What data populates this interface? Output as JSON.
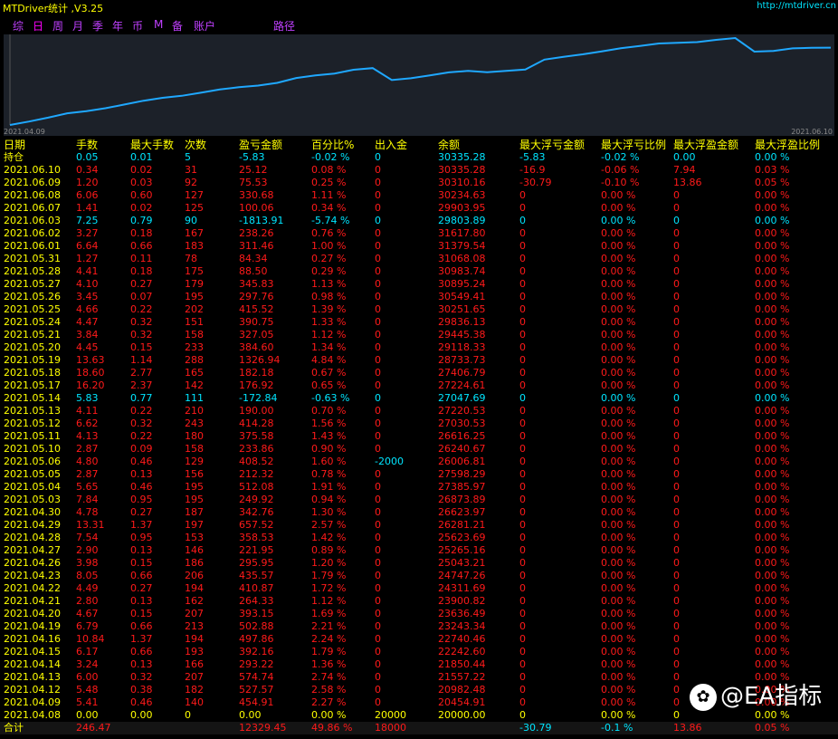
{
  "window": {
    "title": "MTDriver统计 ,V3.25",
    "url": "http://mtdriver.cn"
  },
  "tabs": [
    "综",
    "日",
    "周",
    "月",
    "季",
    "年",
    "币",
    "M",
    "备",
    "账户",
    "路径"
  ],
  "active_tab": 1,
  "chart": {
    "start_label": "2021.04.09",
    "end_label": "2021.06.10",
    "line_color": "#1fa8ff"
  },
  "chart_data": {
    "type": "line",
    "x": [
      "2021.04.08",
      "2021.04.09",
      "2021.04.12",
      "2021.04.13",
      "2021.04.14",
      "2021.04.15",
      "2021.04.16",
      "2021.04.19",
      "2021.04.20",
      "2021.04.21",
      "2021.04.22",
      "2021.04.23",
      "2021.04.26",
      "2021.04.27",
      "2021.04.28",
      "2021.04.29",
      "2021.04.30",
      "2021.05.03",
      "2021.05.04",
      "2021.05.05",
      "2021.05.06",
      "2021.05.10",
      "2021.05.11",
      "2021.05.12",
      "2021.05.13",
      "2021.05.14",
      "2021.05.17",
      "2021.05.18",
      "2021.05.19",
      "2021.05.20",
      "2021.05.21",
      "2021.05.24",
      "2021.05.25",
      "2021.05.26",
      "2021.05.27",
      "2021.05.28",
      "2021.05.31",
      "2021.06.01",
      "2021.06.02",
      "2021.06.03",
      "2021.06.07",
      "2021.06.08",
      "2021.06.09",
      "2021.06.10"
    ],
    "values": [
      20000.0,
      20454.91,
      20982.48,
      21557.22,
      21850.44,
      22242.6,
      22740.46,
      23243.34,
      23636.49,
      23900.82,
      24311.69,
      24747.26,
      25043.21,
      25265.16,
      25623.69,
      26281.21,
      26623.97,
      26873.89,
      27385.97,
      27598.29,
      26006.81,
      26240.67,
      26616.25,
      27030.53,
      27220.53,
      27047.69,
      27224.61,
      27406.79,
      28733.73,
      29118.33,
      29445.38,
      29836.13,
      30251.65,
      30549.41,
      30895.24,
      30983.74,
      31068.08,
      31379.54,
      31617.8,
      29803.89,
      29903.95,
      30234.63,
      30310.16,
      30335.28
    ],
    "xlabel": "",
    "ylabel": "",
    "grid": false
  },
  "table": {
    "headers": [
      "日期",
      "手数",
      "最大手数",
      "次数",
      "盈亏金额",
      "百分比%",
      "出入金",
      "余额",
      "最大浮亏金额",
      "最大浮亏比例",
      "最大浮盈金额",
      "最大浮盈比例"
    ],
    "rows": [
      {
        "c": "cyan",
        "v": [
          "持仓",
          "0.05",
          "0.01",
          "5",
          "-5.83",
          "-0.02 %",
          "0",
          "30335.28",
          "-5.83",
          "-0.02 %",
          "0.00",
          "0.00 %"
        ]
      },
      {
        "c": "red",
        "v": [
          "2021.06.10",
          "0.34",
          "0.02",
          "31",
          "25.12",
          "0.08 %",
          "0",
          "30335.28",
          "-16.9",
          "-0.06 %",
          "7.94",
          "0.03 %"
        ]
      },
      {
        "c": "red",
        "v": [
          "2021.06.09",
          "1.20",
          "0.03",
          "92",
          "75.53",
          "0.25 %",
          "0",
          "30310.16",
          "-30.79",
          "-0.10 %",
          "13.86",
          "0.05 %"
        ]
      },
      {
        "c": "red",
        "v": [
          "2021.06.08",
          "6.06",
          "0.60",
          "127",
          "330.68",
          "1.11 %",
          "0",
          "30234.63",
          "0",
          "0.00 %",
          "0",
          "0.00 %"
        ]
      },
      {
        "c": "red",
        "v": [
          "2021.06.07",
          "1.41",
          "0.02",
          "125",
          "100.06",
          "0.34 %",
          "0",
          "29903.95",
          "0",
          "0.00 %",
          "0",
          "0.00 %"
        ]
      },
      {
        "c": "cyan",
        "v": [
          "2021.06.03",
          "7.25",
          "0.79",
          "90",
          "-1813.91",
          "-5.74 %",
          "0",
          "29803.89",
          "0",
          "0.00 %",
          "0",
          "0.00 %"
        ]
      },
      {
        "c": "red",
        "v": [
          "2021.06.02",
          "3.27",
          "0.18",
          "167",
          "238.26",
          "0.76 %",
          "0",
          "31617.80",
          "0",
          "0.00 %",
          "0",
          "0.00 %"
        ]
      },
      {
        "c": "red",
        "v": [
          "2021.06.01",
          "6.64",
          "0.66",
          "183",
          "311.46",
          "1.00 %",
          "0",
          "31379.54",
          "0",
          "0.00 %",
          "0",
          "0.00 %"
        ]
      },
      {
        "c": "red",
        "v": [
          "2021.05.31",
          "1.27",
          "0.11",
          "78",
          "84.34",
          "0.27 %",
          "0",
          "31068.08",
          "0",
          "0.00 %",
          "0",
          "0.00 %"
        ]
      },
      {
        "c": "red",
        "v": [
          "2021.05.28",
          "4.41",
          "0.18",
          "175",
          "88.50",
          "0.29 %",
          "0",
          "30983.74",
          "0",
          "0.00 %",
          "0",
          "0.00 %"
        ]
      },
      {
        "c": "red",
        "v": [
          "2021.05.27",
          "4.10",
          "0.27",
          "179",
          "345.83",
          "1.13 %",
          "0",
          "30895.24",
          "0",
          "0.00 %",
          "0",
          "0.00 %"
        ]
      },
      {
        "c": "red",
        "v": [
          "2021.05.26",
          "3.45",
          "0.07",
          "195",
          "297.76",
          "0.98 %",
          "0",
          "30549.41",
          "0",
          "0.00 %",
          "0",
          "0.00 %"
        ]
      },
      {
        "c": "red",
        "v": [
          "2021.05.25",
          "4.66",
          "0.22",
          "202",
          "415.52",
          "1.39 %",
          "0",
          "30251.65",
          "0",
          "0.00 %",
          "0",
          "0.00 %"
        ]
      },
      {
        "c": "red",
        "v": [
          "2021.05.24",
          "4.47",
          "0.32",
          "151",
          "390.75",
          "1.33 %",
          "0",
          "29836.13",
          "0",
          "0.00 %",
          "0",
          "0.00 %"
        ]
      },
      {
        "c": "red",
        "v": [
          "2021.05.21",
          "3.84",
          "0.32",
          "158",
          "327.05",
          "1.12 %",
          "0",
          "29445.38",
          "0",
          "0.00 %",
          "0",
          "0.00 %"
        ]
      },
      {
        "c": "red",
        "v": [
          "2021.05.20",
          "4.45",
          "0.15",
          "233",
          "384.60",
          "1.34 %",
          "0",
          "29118.33",
          "0",
          "0.00 %",
          "0",
          "0.00 %"
        ]
      },
      {
        "c": "red",
        "v": [
          "2021.05.19",
          "13.63",
          "1.14",
          "288",
          "1326.94",
          "4.84 %",
          "0",
          "28733.73",
          "0",
          "0.00 %",
          "0",
          "0.00 %"
        ]
      },
      {
        "c": "red",
        "v": [
          "2021.05.18",
          "18.60",
          "2.77",
          "165",
          "182.18",
          "0.67 %",
          "0",
          "27406.79",
          "0",
          "0.00 %",
          "0",
          "0.00 %"
        ]
      },
      {
        "c": "red",
        "v": [
          "2021.05.17",
          "16.20",
          "2.37",
          "142",
          "176.92",
          "0.65 %",
          "0",
          "27224.61",
          "0",
          "0.00 %",
          "0",
          "0.00 %"
        ]
      },
      {
        "c": "cyan",
        "v": [
          "2021.05.14",
          "5.83",
          "0.77",
          "111",
          "-172.84",
          "-0.63 %",
          "0",
          "27047.69",
          "0",
          "0.00 %",
          "0",
          "0.00 %"
        ]
      },
      {
        "c": "red",
        "v": [
          "2021.05.13",
          "4.11",
          "0.22",
          "210",
          "190.00",
          "0.70 %",
          "0",
          "27220.53",
          "0",
          "0.00 %",
          "0",
          "0.00 %"
        ]
      },
      {
        "c": "red",
        "v": [
          "2021.05.12",
          "6.62",
          "0.32",
          "243",
          "414.28",
          "1.56 %",
          "0",
          "27030.53",
          "0",
          "0.00 %",
          "0",
          "0.00 %"
        ]
      },
      {
        "c": "red",
        "v": [
          "2021.05.11",
          "4.13",
          "0.22",
          "180",
          "375.58",
          "1.43 %",
          "0",
          "26616.25",
          "0",
          "0.00 %",
          "0",
          "0.00 %"
        ]
      },
      {
        "c": "red",
        "v": [
          "2021.05.10",
          "2.87",
          "0.09",
          "158",
          "233.86",
          "0.90 %",
          "0",
          "26240.67",
          "0",
          "0.00 %",
          "0",
          "0.00 %"
        ]
      },
      {
        "c": "red",
        "v": [
          "2021.05.06",
          "4.80",
          "0.46",
          "129",
          "408.52",
          "1.60 %",
          "-2000",
          "26006.81",
          "0",
          "0.00 %",
          "0",
          "0.00 %"
        ]
      },
      {
        "c": "red",
        "v": [
          "2021.05.05",
          "2.87",
          "0.13",
          "156",
          "212.32",
          "0.78 %",
          "0",
          "27598.29",
          "0",
          "0.00 %",
          "0",
          "0.00 %"
        ]
      },
      {
        "c": "red",
        "v": [
          "2021.05.04",
          "5.65",
          "0.46",
          "195",
          "512.08",
          "1.91 %",
          "0",
          "27385.97",
          "0",
          "0.00 %",
          "0",
          "0.00 %"
        ]
      },
      {
        "c": "red",
        "v": [
          "2021.05.03",
          "7.84",
          "0.95",
          "195",
          "249.92",
          "0.94 %",
          "0",
          "26873.89",
          "0",
          "0.00 %",
          "0",
          "0.00 %"
        ]
      },
      {
        "c": "red",
        "v": [
          "2021.04.30",
          "4.78",
          "0.27",
          "187",
          "342.76",
          "1.30 %",
          "0",
          "26623.97",
          "0",
          "0.00 %",
          "0",
          "0.00 %"
        ]
      },
      {
        "c": "red",
        "v": [
          "2021.04.29",
          "13.31",
          "1.37",
          "197",
          "657.52",
          "2.57 %",
          "0",
          "26281.21",
          "0",
          "0.00 %",
          "0",
          "0.00 %"
        ]
      },
      {
        "c": "red",
        "v": [
          "2021.04.28",
          "7.54",
          "0.95",
          "153",
          "358.53",
          "1.42 %",
          "0",
          "25623.69",
          "0",
          "0.00 %",
          "0",
          "0.00 %"
        ]
      },
      {
        "c": "red",
        "v": [
          "2021.04.27",
          "2.90",
          "0.13",
          "146",
          "221.95",
          "0.89 %",
          "0",
          "25265.16",
          "0",
          "0.00 %",
          "0",
          "0.00 %"
        ]
      },
      {
        "c": "red",
        "v": [
          "2021.04.26",
          "3.98",
          "0.15",
          "186",
          "295.95",
          "1.20 %",
          "0",
          "25043.21",
          "0",
          "0.00 %",
          "0",
          "0.00 %"
        ]
      },
      {
        "c": "red",
        "v": [
          "2021.04.23",
          "8.05",
          "0.66",
          "206",
          "435.57",
          "1.79 %",
          "0",
          "24747.26",
          "0",
          "0.00 %",
          "0",
          "0.00 %"
        ]
      },
      {
        "c": "red",
        "v": [
          "2021.04.22",
          "4.49",
          "0.27",
          "194",
          "410.87",
          "1.72 %",
          "0",
          "24311.69",
          "0",
          "0.00 %",
          "0",
          "0.00 %"
        ]
      },
      {
        "c": "red",
        "v": [
          "2021.04.21",
          "2.80",
          "0.13",
          "162",
          "264.33",
          "1.12 %",
          "0",
          "23900.82",
          "0",
          "0.00 %",
          "0",
          "0.00 %"
        ]
      },
      {
        "c": "red",
        "v": [
          "2021.04.20",
          "4.67",
          "0.15",
          "207",
          "393.15",
          "1.69 %",
          "0",
          "23636.49",
          "0",
          "0.00 %",
          "0",
          "0.00 %"
        ]
      },
      {
        "c": "red",
        "v": [
          "2021.04.19",
          "6.79",
          "0.66",
          "213",
          "502.88",
          "2.21 %",
          "0",
          "23243.34",
          "0",
          "0.00 %",
          "0",
          "0.00 %"
        ]
      },
      {
        "c": "red",
        "v": [
          "2021.04.16",
          "10.84",
          "1.37",
          "194",
          "497.86",
          "2.24 %",
          "0",
          "22740.46",
          "0",
          "0.00 %",
          "0",
          "0.00 %"
        ]
      },
      {
        "c": "red",
        "v": [
          "2021.04.15",
          "6.17",
          "0.66",
          "193",
          "392.16",
          "1.79 %",
          "0",
          "22242.60",
          "0",
          "0.00 %",
          "0",
          "0.00 %"
        ]
      },
      {
        "c": "red",
        "v": [
          "2021.04.14",
          "3.24",
          "0.13",
          "166",
          "293.22",
          "1.36 %",
          "0",
          "21850.44",
          "0",
          "0.00 %",
          "0",
          "0.00 %"
        ]
      },
      {
        "c": "red",
        "v": [
          "2021.04.13",
          "6.00",
          "0.32",
          "207",
          "574.74",
          "2.74 %",
          "0",
          "21557.22",
          "0",
          "0.00 %",
          "0",
          "0.00 %"
        ]
      },
      {
        "c": "red",
        "v": [
          "2021.04.12",
          "5.48",
          "0.38",
          "182",
          "527.57",
          "2.58 %",
          "0",
          "20982.48",
          "0",
          "0.00 %",
          "0",
          "0.00 %"
        ]
      },
      {
        "c": "red",
        "v": [
          "2021.04.09",
          "5.41",
          "0.46",
          "140",
          "454.91",
          "2.27 %",
          "0",
          "20454.91",
          "0",
          "0.00 %",
          "0",
          "0.00 %"
        ]
      },
      {
        "c": "yel",
        "v": [
          "2021.04.08",
          "0.00",
          "0.00",
          "0",
          "0.00",
          "0.00 %",
          "20000",
          "20000.00",
          "0",
          "0.00 %",
          "0",
          "0.00 %"
        ]
      }
    ],
    "total": [
      "合计",
      "246.47",
      "",
      "",
      "12329.45",
      "49.86 %",
      "18000",
      "",
      "-30.79",
      "-0.1 %",
      "13.86",
      "0.05 %"
    ]
  },
  "colors": {
    "red": "#ff1a1a",
    "cyan": "#00e5ff",
    "yellow": "#ffff00",
    "tab": "#c040ff"
  },
  "watermark": {
    "icon": "wechat-channels-icon",
    "text": "@EA指标"
  }
}
